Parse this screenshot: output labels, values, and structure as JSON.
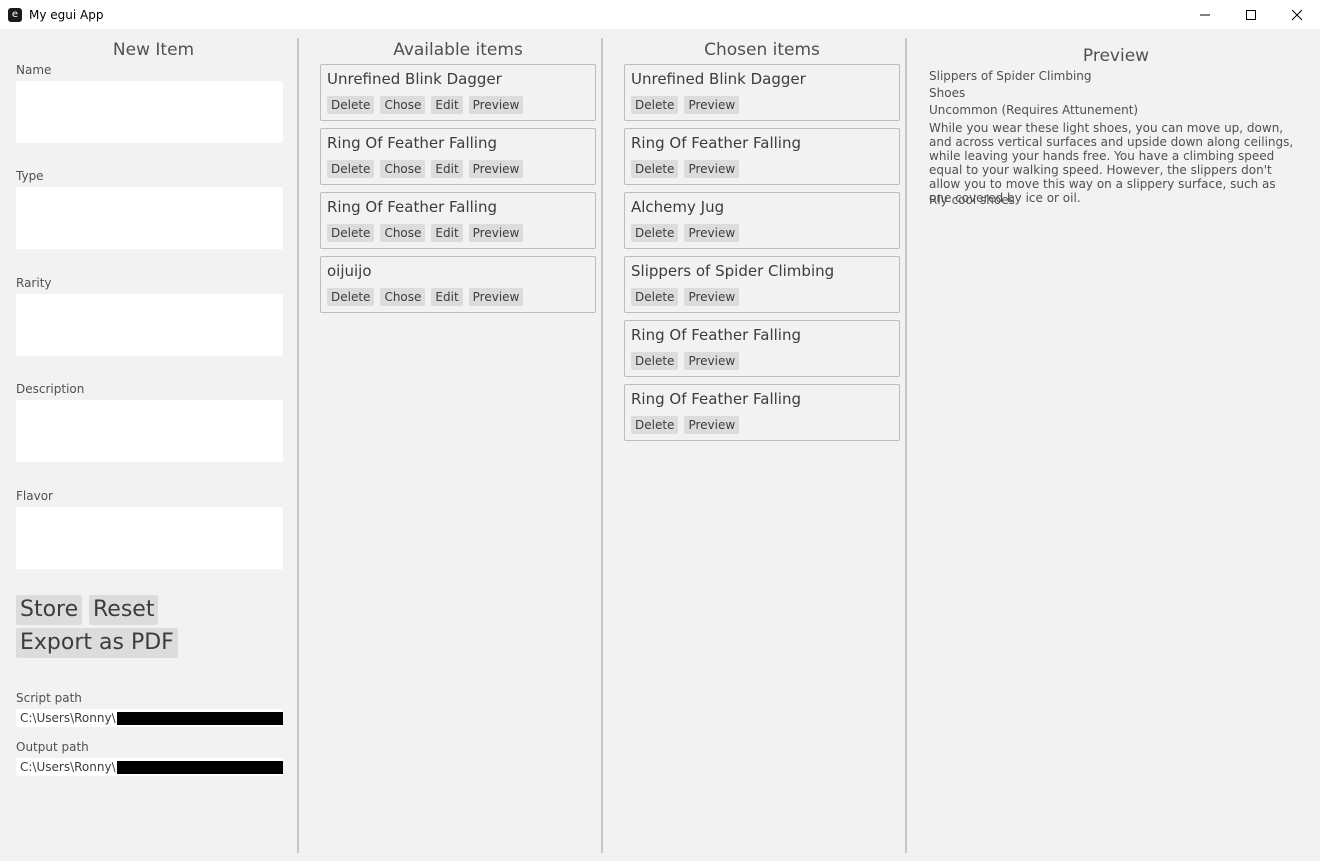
{
  "window": {
    "title": "My egui App",
    "app_icon": "e"
  },
  "new_item": {
    "heading": "New Item",
    "fields": [
      {
        "label": "Name",
        "value": ""
      },
      {
        "label": "Type",
        "value": ""
      },
      {
        "label": "Rarity",
        "value": ""
      },
      {
        "label": "Description",
        "value": ""
      },
      {
        "label": "Flavor",
        "value": ""
      }
    ],
    "store_label": "Store",
    "reset_label": "Reset",
    "export_label": "Export as PDF",
    "script_path_label": "Script path",
    "script_path_value": "C:\\Users\\Ronny\\",
    "output_path_label": "Output path",
    "output_path_value": "C:\\Users\\Ronny\\"
  },
  "available": {
    "heading": "Available items",
    "buttons": {
      "delete": "Delete",
      "chose": "Chose",
      "edit": "Edit",
      "preview": "Preview"
    },
    "items": [
      {
        "name": "Unrefined Blink Dagger"
      },
      {
        "name": "Ring Of Feather Falling"
      },
      {
        "name": "Ring Of Feather Falling"
      },
      {
        "name": "oijuijo"
      }
    ]
  },
  "chosen": {
    "heading": "Chosen items",
    "buttons": {
      "delete": "Delete",
      "preview": "Preview"
    },
    "items": [
      {
        "name": "Unrefined Blink Dagger"
      },
      {
        "name": "Ring Of Feather Falling"
      },
      {
        "name": "Alchemy Jug"
      },
      {
        "name": "Slippers of Spider Climbing"
      },
      {
        "name": "Ring Of Feather Falling"
      },
      {
        "name": "Ring Of Feather Falling"
      }
    ]
  },
  "preview": {
    "heading": "Preview",
    "name": "Slippers of Spider Climbing",
    "type": "Shoes",
    "rarity": "Uncommon (Requires Attunement)",
    "description": "While you wear these light shoes, you can move up, down, and across vertical surfaces and upside down along ceilings, while leaving your hands free. You have a climbing speed equal to your walking speed. However, the slippers don't allow you to move this way on a slippery surface, such as one covered by ice or oil.",
    "flavor": "Rly cool shoes"
  }
}
